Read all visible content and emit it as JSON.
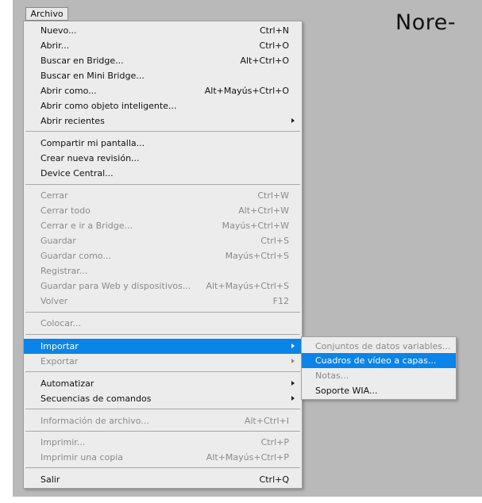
{
  "menubar": {
    "archivo_label": "Archivo"
  },
  "watermark": "Nore-",
  "menu": {
    "nuevo": {
      "label": "Nuevo...",
      "shortcut": "Ctrl+N"
    },
    "abrir": {
      "label": "Abrir...",
      "shortcut": "Ctrl+O"
    },
    "buscar_bridge": {
      "label": "Buscar en Bridge...",
      "shortcut": "Alt+Ctrl+O"
    },
    "buscar_mini": {
      "label": "Buscar en Mini Bridge..."
    },
    "abrir_como": {
      "label": "Abrir como...",
      "shortcut": "Alt+Mayús+Ctrl+O"
    },
    "abrir_objeto": {
      "label": "Abrir como objeto inteligente..."
    },
    "abrir_recientes": {
      "label": "Abrir recientes"
    },
    "compartir": {
      "label": "Compartir mi pantalla..."
    },
    "crear_revision": {
      "label": "Crear nueva revisión..."
    },
    "device_central": {
      "label": "Device Central..."
    },
    "cerrar": {
      "label": "Cerrar",
      "shortcut": "Ctrl+W"
    },
    "cerrar_todo": {
      "label": "Cerrar todo",
      "shortcut": "Alt+Ctrl+W"
    },
    "cerrar_bridge": {
      "label": "Cerrar e ir a Bridge...",
      "shortcut": "Mayús+Ctrl+W"
    },
    "guardar": {
      "label": "Guardar",
      "shortcut": "Ctrl+S"
    },
    "guardar_como": {
      "label": "Guardar como...",
      "shortcut": "Mayús+Ctrl+S"
    },
    "registrar": {
      "label": "Registrar..."
    },
    "guardar_web": {
      "label": "Guardar para Web y dispositivos...",
      "shortcut": "Alt+Mayús+Ctrl+S"
    },
    "volver": {
      "label": "Volver",
      "shortcut": "F12"
    },
    "colocar": {
      "label": "Colocar..."
    },
    "importar": {
      "label": "Importar"
    },
    "exportar": {
      "label": "Exportar"
    },
    "automatizar": {
      "label": "Automatizar"
    },
    "secuencias": {
      "label": "Secuencias de comandos"
    },
    "informacion": {
      "label": "Información de archivo...",
      "shortcut": "Alt+Ctrl+I"
    },
    "imprimir": {
      "label": "Imprimir...",
      "shortcut": "Ctrl+P"
    },
    "imprimir_copia": {
      "label": "Imprimir una copia",
      "shortcut": "Alt+Mayús+Ctrl+P"
    },
    "salir": {
      "label": "Salir",
      "shortcut": "Ctrl+Q"
    }
  },
  "submenu": {
    "conjuntos": "Conjuntos de datos variables...",
    "cuadros_video": "Cuadros de vídeo a capas...",
    "notas": "Notas...",
    "soporte_wia": "Soporte WIA..."
  },
  "colors": {
    "highlight": "#0a84e8",
    "menu_bg": "#ececec",
    "disabled_text": "#8a8a8a",
    "canvas": "#b9b9b9"
  }
}
